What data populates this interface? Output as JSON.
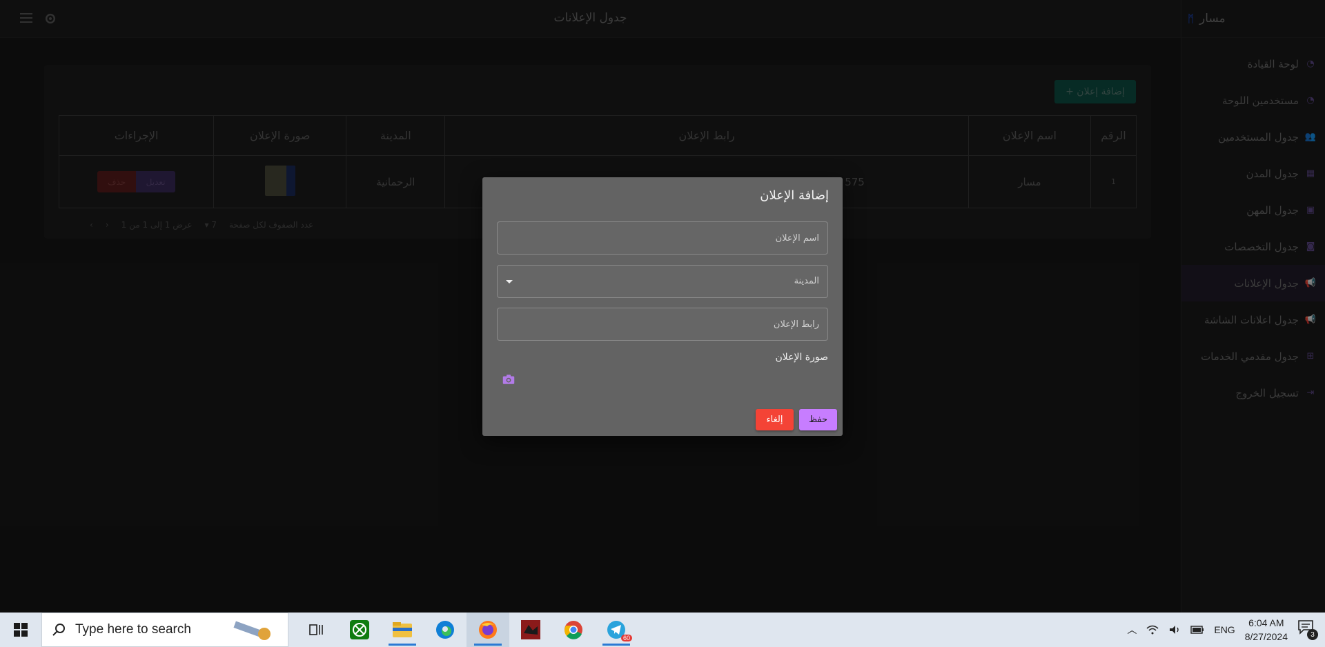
{
  "app": {
    "page_title": "جدول الإعلانات",
    "brand": "مسار"
  },
  "sidebar": {
    "items": [
      {
        "label": "لوحة القيادة",
        "icon": "dashboard-icon"
      },
      {
        "label": "مستخدمين اللوحة",
        "icon": "dashboard-icon"
      },
      {
        "label": "جدول المستخدمين",
        "icon": "users-icon"
      },
      {
        "label": "جدول المدن",
        "icon": "city-icon"
      },
      {
        "label": "جدول المهن",
        "icon": "briefcase-icon"
      },
      {
        "label": "جدول التخصصات",
        "icon": "badge-icon"
      },
      {
        "label": "جدول الإعلانات",
        "icon": "megaphone-icon"
      },
      {
        "label": "جدول اعلانات الشاشة",
        "icon": "megaphone-icon"
      },
      {
        "label": "جدول مقدمي الخدمات",
        "icon": "toolbox-icon"
      },
      {
        "label": "تسجيل الخروج",
        "icon": "logout-icon"
      }
    ],
    "active_index": 6
  },
  "table": {
    "add_button": "إضافة إعلان +",
    "headers": [
      "الرقم",
      "اسم الإعلان",
      "رابط الإعلان",
      "المدينة",
      "صورة الإعلان",
      "الإجراءات"
    ],
    "rows": [
      {
        "number": "1",
        "name": "مسار",
        "link": "575",
        "city": "الرحمانية",
        "edit": "تعديل",
        "delete": "حذف"
      }
    ],
    "pager": {
      "rows_per_page_label": "عدد الصفوف لكل صفحة",
      "rows_per_page": "7",
      "range": "عرض 1 إلى 1 من 1"
    }
  },
  "dialog": {
    "title": "إضافة الإعلان",
    "name_placeholder": "اسم الإعلان",
    "city_placeholder": "المدينة",
    "link_placeholder": "رابط الإعلان",
    "image_label": "صورة الإعلان",
    "save": "حفظ",
    "cancel": "إلغاء"
  },
  "taskbar": {
    "search_placeholder": "Type here to search",
    "language": "ENG",
    "time": "6:04 AM",
    "date": "8/27/2024",
    "telegram_badge": "60",
    "notifications": "3"
  },
  "colors": {
    "accent": "#c77dff",
    "danger": "#f44336",
    "teal": "#0d4f44"
  }
}
